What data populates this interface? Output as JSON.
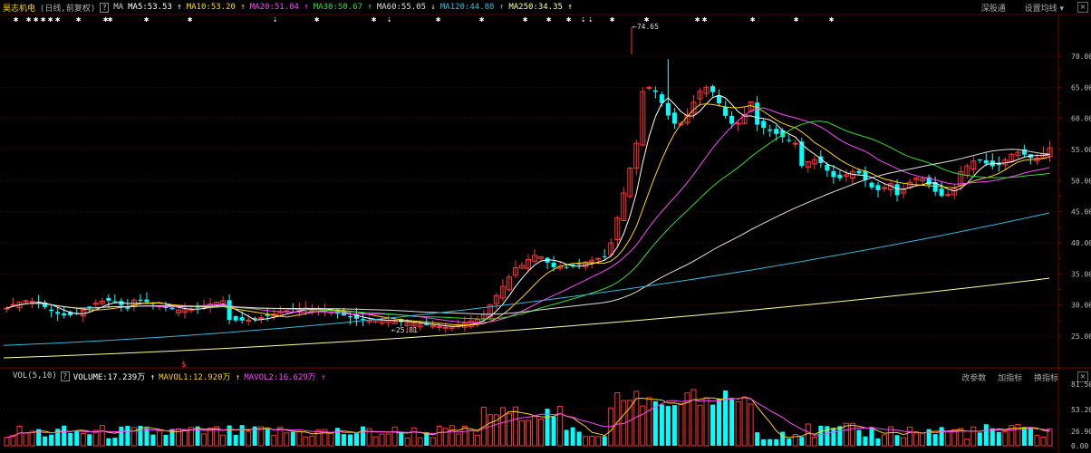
{
  "header": {
    "stock_name": "昊志机电",
    "mode": "(日线,前复权)",
    "help": "?",
    "indicator": "MA",
    "ma": [
      {
        "label": "MA5:53.53",
        "color": "#ffffff",
        "arrow": "↑"
      },
      {
        "label": "MA10:53.20",
        "color": "#ffd400",
        "arrow": "↑"
      },
      {
        "label": "MA20:51.04",
        "color": "#ff44ff",
        "arrow": "↑"
      },
      {
        "label": "MA30:50.67",
        "color": "#33dd33",
        "arrow": "↑"
      },
      {
        "label": "MA60:55.05",
        "color": "#dddddd",
        "arrow": "↓"
      },
      {
        "label": "MA120:44.88",
        "color": "#33bbdd",
        "arrow": "↑"
      },
      {
        "label": "MA250:34.35",
        "color": "#ffff99",
        "arrow": "↑"
      }
    ],
    "tools": [
      "深股通",
      "设置均线 ▾"
    ],
    "close": "×"
  },
  "volume_header": {
    "title": "VOL(5,10)",
    "help": "?",
    "items": [
      {
        "label": "VOLUME:17.239万",
        "color": "#ffffff",
        "arrow": "↑"
      },
      {
        "label": "MAVOL1:12.920万",
        "color": "#ffd400",
        "arrow": "↑"
      },
      {
        "label": "MAVOL2:16.629万",
        "color": "#ff44ff",
        "arrow": "↑"
      }
    ],
    "tools": [
      "改参数",
      "加指标",
      "换指标"
    ],
    "close": "×"
  },
  "axes": {
    "price_ticks": [
      "70.00",
      "65.00",
      "60.00",
      "55.00",
      "50.00",
      "45.00",
      "40.00",
      "35.00",
      "30.00",
      "25.00"
    ],
    "volume_ticks": [
      "81.50",
      "53.20",
      "26.90",
      "0.00"
    ]
  },
  "annotations": {
    "high": "←74.65",
    "low": "←25.81",
    "dollar": "$"
  },
  "colors": {
    "up": "#ff3333",
    "down": "#00ffff",
    "grid": "#5a0000"
  }
}
